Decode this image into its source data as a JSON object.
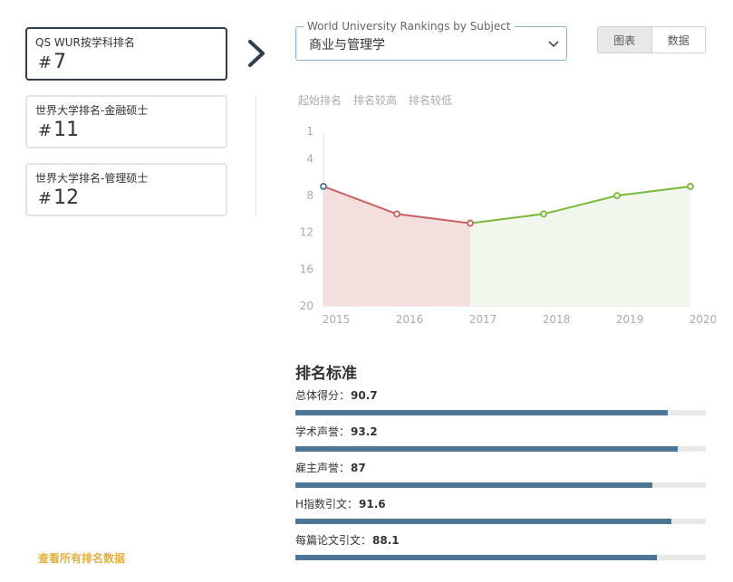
{
  "cards": [
    {
      "title": "QS WUR按学科排名",
      "hash": "#",
      "rank": "7",
      "active": true
    },
    {
      "title": "世界大学排名-金融硕士",
      "hash": "#",
      "rank": "11",
      "active": false
    },
    {
      "title": "世界大学排名-管理硕士",
      "hash": "#",
      "rank": "12",
      "active": false
    }
  ],
  "subject_select": {
    "legend": "World University Rankings by Subject",
    "value": "商业与管理学"
  },
  "view_toggle": {
    "chart_label": "图表",
    "data_label": "数据",
    "active": "chart"
  },
  "chart_tabs": [
    "起始排名",
    "排名较高",
    "排名较低"
  ],
  "colors": {
    "down_line": "#c86060",
    "down_fill": "#f5dede",
    "up_line": "#7ab83a",
    "up_fill": "#f2f7ee",
    "start_point": "#4a7596",
    "bar": "#4a7596",
    "link": "#e0b13d"
  },
  "chart_data": {
    "type": "line",
    "x": [
      2015,
      2016,
      2017,
      2018,
      2019,
      2020
    ],
    "y": [
      7,
      10,
      11,
      10,
      8,
      7
    ],
    "y_axis_ticks": [
      1,
      4,
      8,
      12,
      16,
      20
    ],
    "ylim": [
      1,
      20
    ],
    "y_inverted": true,
    "title": "",
    "xlabel": "",
    "ylabel": "",
    "segments": [
      {
        "from": 2015,
        "to": 2017,
        "trend": "down"
      },
      {
        "from": 2017,
        "to": 2020,
        "trend": "up"
      }
    ]
  },
  "criteria": {
    "title": "排名标准",
    "items": [
      {
        "label": "总体得分：",
        "value": "90.7",
        "score": 90.7
      },
      {
        "label": "学术声誉：",
        "value": "93.2",
        "score": 93.2
      },
      {
        "label": "雇主声誉：",
        "value": "87",
        "score": 87
      },
      {
        "label": "H指数引文：",
        "value": "91.6",
        "score": 91.6
      },
      {
        "label": "每篇论文引文：",
        "value": "88.1",
        "score": 88.1
      }
    ]
  },
  "all_data_link": "查看所有排名数据"
}
